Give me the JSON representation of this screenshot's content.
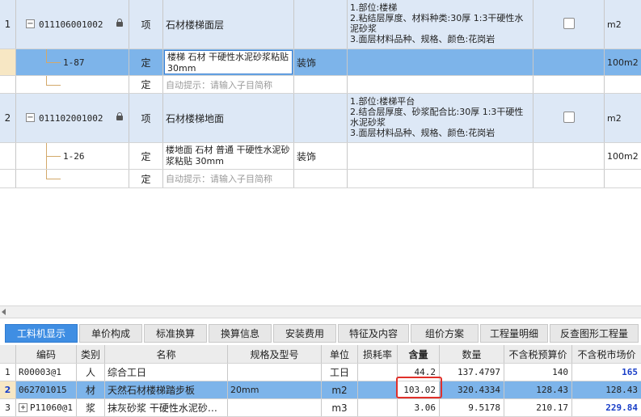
{
  "top_rows": [
    {
      "index": "1",
      "code": "011106001002",
      "type": "项",
      "name": "石材楼梯面层",
      "spec": "",
      "features": "1.部位:楼梯\n2.粘结层厚度、材料种类:30厚 1:3干硬性水泥砂浆\n3.面层材料品种、规格、颜色:花岗岩",
      "unit": "m2"
    },
    {
      "index": "",
      "code": "1-87",
      "type": "定",
      "name": "楼梯 石材 干硬性水泥砂浆粘贴 30mm",
      "spec": "装饰",
      "features": "",
      "unit": "100m2"
    },
    {
      "index": "",
      "code": "",
      "type": "定",
      "name": "自动提示：请输入子目简称",
      "spec": "",
      "features": "",
      "unit": ""
    },
    {
      "index": "2",
      "code": "011102001002",
      "type": "项",
      "name": "石材楼梯地面",
      "spec": "",
      "features": "1.部位:楼梯平台\n2.结合层厚度、砂浆配合比:30厚 1:3干硬性水泥砂浆\n3.面层材料品种、规格、颜色:花岗岩",
      "unit": "m2"
    },
    {
      "index": "",
      "code": "1-26",
      "type": "定",
      "name": "楼地面 石材 普通 干硬性水泥砂浆粘贴 30mm",
      "spec": "装饰",
      "features": "",
      "unit": "100m2"
    },
    {
      "index": "",
      "code": "",
      "type": "定",
      "name": "自动提示：请输入子目简称",
      "spec": "",
      "features": "",
      "unit": ""
    }
  ],
  "tabs": [
    "工料机显示",
    "单价构成",
    "标准换算",
    "换算信息",
    "安装费用",
    "特征及内容",
    "组价方案",
    "工程量明细",
    "反查图形工程量"
  ],
  "bottom_header": {
    "code": "编码",
    "type": "类别",
    "name": "名称",
    "spec": "规格及型号",
    "unit": "单位",
    "loss": "损耗率",
    "qty": "含量",
    "amount": "数量",
    "budget": "不含税预算价",
    "market": "不含税市场价"
  },
  "bottom_rows": [
    {
      "index": "1",
      "code": "R00003@1",
      "type": "人",
      "name": "综合工日",
      "spec": "",
      "unit": "工日",
      "loss": "",
      "qty": "44.2",
      "amount": "137.4797",
      "budget": "140",
      "market": "165"
    },
    {
      "index": "2",
      "code": "062701015",
      "type": "材",
      "name": "天然石材楼梯踏步板",
      "spec": "20mm",
      "unit": "m2",
      "loss": "",
      "qty": "103.02",
      "amount": "320.4334",
      "budget": "128.43",
      "market": "128.43"
    },
    {
      "index": "3",
      "code": "P11060@1",
      "type": "浆",
      "name": "抹灰砂浆 干硬性水泥砂…",
      "spec": "",
      "unit": "m3",
      "loss": "",
      "qty": "3.06",
      "amount": "9.5178",
      "budget": "210.17",
      "market": "229.84"
    }
  ],
  "colors": {
    "selected_row": "#7db4ea",
    "item_row": "#dde8f6",
    "active_tab": "#3f8ee3",
    "highlight_border": "#e0302a",
    "market_price_text": "#1a3fc8"
  },
  "icons": [
    "collapse-minus-icon",
    "lock-icon",
    "checkbox",
    "expand-plus-icon",
    "scroll-left-arrow-icon"
  ]
}
